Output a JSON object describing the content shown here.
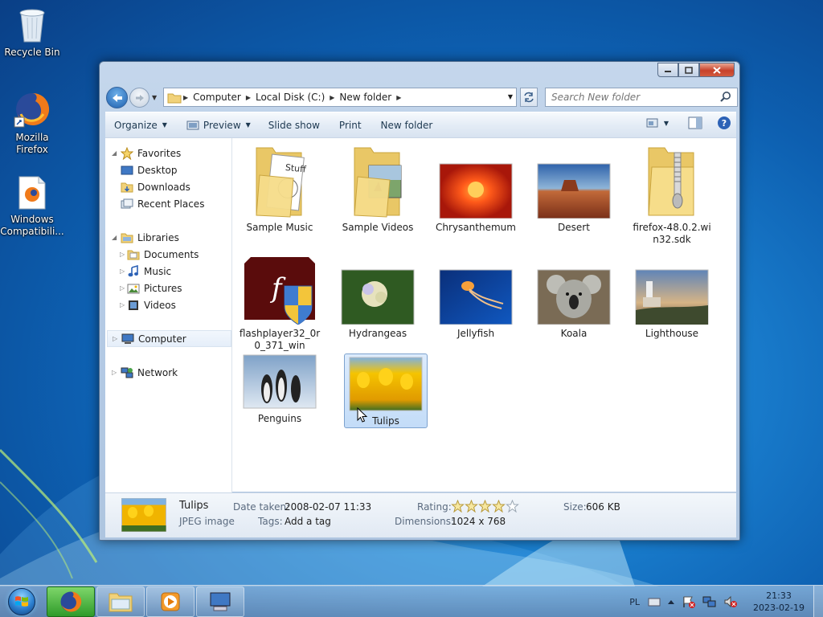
{
  "desktop": {
    "icons": [
      {
        "label": "Recycle Bin"
      },
      {
        "label": "Mozilla Firefox"
      },
      {
        "label": "Windows Compatibili..."
      }
    ]
  },
  "window": {
    "address": {
      "crumbs": [
        "Computer",
        "Local Disk (C:)",
        "New folder"
      ]
    },
    "search": {
      "placeholder": "Search New folder"
    },
    "toolbar": {
      "organize": "Organize",
      "preview": "Preview",
      "slideshow": "Slide show",
      "print": "Print",
      "new_folder": "New folder"
    },
    "nav_pane": {
      "favorites": "Favorites",
      "desktop": "Desktop",
      "downloads": "Downloads",
      "recent": "Recent Places",
      "libraries": "Libraries",
      "documents": "Documents",
      "music": "Music",
      "pictures": "Pictures",
      "videos": "Videos",
      "computer": "Computer",
      "network": "Network"
    },
    "files": [
      {
        "name": "Sample Music",
        "kind": "folder"
      },
      {
        "name": "Sample Videos",
        "kind": "folder"
      },
      {
        "name": "Chrysanthemum",
        "kind": "image",
        "colors": [
          "#ff5a1a",
          "#c21d06"
        ]
      },
      {
        "name": "Desert",
        "kind": "image",
        "colors": [
          "#3d73b8",
          "#b6512b"
        ]
      },
      {
        "name": "firefox-48.0.2.win32.sdk",
        "kind": "zip"
      },
      {
        "name": "flashplayer32_0r0_371_win",
        "kind": "flash"
      },
      {
        "name": "Hydrangeas",
        "kind": "image",
        "colors": [
          "#3e6b2a",
          "#dcd9b4"
        ]
      },
      {
        "name": "Jellyfish",
        "kind": "image",
        "colors": [
          "#0c3a8c",
          "#f08a2e"
        ]
      },
      {
        "name": "Koala",
        "kind": "image",
        "colors": [
          "#6e6e64",
          "#cfcfc8"
        ]
      },
      {
        "name": "Lighthouse",
        "kind": "image",
        "colors": [
          "#5b7fb2",
          "#d29a4e"
        ]
      },
      {
        "name": "Penguins",
        "kind": "image",
        "colors": [
          "#9ab4cf",
          "#222222"
        ]
      },
      {
        "name": "Tulips",
        "kind": "image",
        "colors": [
          "#f0b400",
          "#4c7a2c"
        ]
      }
    ],
    "details": {
      "name": "Tulips",
      "type": "JPEG image",
      "date_label": "Date taken:",
      "date_value": "2008-02-07 11:33",
      "tags_label": "Tags:",
      "tags_value": "Add a tag",
      "rating_label": "Rating:",
      "rating_value": 4,
      "rating_max": 5,
      "dims_label": "Dimensions:",
      "dims_value": "1024 x 768",
      "size_label": "Size:",
      "size_value": "606 KB"
    }
  },
  "taskbar": {
    "lang": "PL",
    "time": "21:33",
    "date": "2023-02-19"
  }
}
